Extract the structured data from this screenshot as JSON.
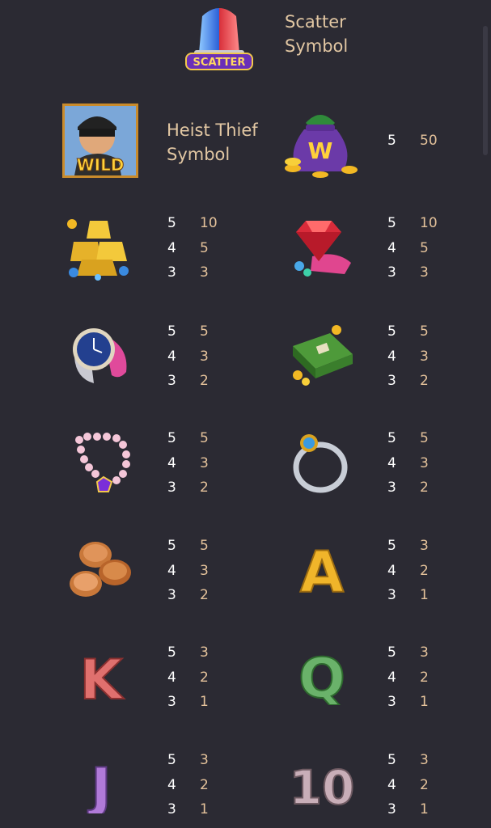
{
  "scatter": {
    "badge": "SCATTER",
    "label": "Scatter\nSymbol"
  },
  "wild": {
    "badge": "WILD",
    "label": "Heist Thief\nSymbol"
  },
  "icons": {
    "scatter": "siren-scatter-icon",
    "wild": "thief-wild-icon",
    "bag": "money-bag-w-icon",
    "gold": "gold-bars-icon",
    "ruby": "ruby-gem-icon",
    "watch": "wristwatch-icon",
    "cash": "cash-stack-icon",
    "necklace": "pearl-necklace-icon",
    "ring": "ring-icon",
    "coins": "coins-icon",
    "a": "letter-a-icon",
    "k": "letter-k-icon",
    "q": "letter-q-icon",
    "j": "letter-j-icon",
    "ten": "number-ten-icon"
  },
  "letters": {
    "w": "W",
    "a": "A",
    "k": "K",
    "q": "Q",
    "j": "J",
    "ten": "10"
  },
  "paytables": {
    "bag": [
      {
        "count": "5",
        "pay": "50"
      }
    ],
    "gold": [
      {
        "count": "5",
        "pay": "10"
      },
      {
        "count": "4",
        "pay": "5"
      },
      {
        "count": "3",
        "pay": "3"
      }
    ],
    "ruby": [
      {
        "count": "5",
        "pay": "10"
      },
      {
        "count": "4",
        "pay": "5"
      },
      {
        "count": "3",
        "pay": "3"
      }
    ],
    "watch": [
      {
        "count": "5",
        "pay": "5"
      },
      {
        "count": "4",
        "pay": "3"
      },
      {
        "count": "3",
        "pay": "2"
      }
    ],
    "cash": [
      {
        "count": "5",
        "pay": "5"
      },
      {
        "count": "4",
        "pay": "3"
      },
      {
        "count": "3",
        "pay": "2"
      }
    ],
    "necklace": [
      {
        "count": "5",
        "pay": "5"
      },
      {
        "count": "4",
        "pay": "3"
      },
      {
        "count": "3",
        "pay": "2"
      }
    ],
    "ring": [
      {
        "count": "5",
        "pay": "5"
      },
      {
        "count": "4",
        "pay": "3"
      },
      {
        "count": "3",
        "pay": "2"
      }
    ],
    "coins": [
      {
        "count": "5",
        "pay": "5"
      },
      {
        "count": "4",
        "pay": "3"
      },
      {
        "count": "3",
        "pay": "2"
      }
    ],
    "a": [
      {
        "count": "5",
        "pay": "3"
      },
      {
        "count": "4",
        "pay": "2"
      },
      {
        "count": "3",
        "pay": "1"
      }
    ],
    "k": [
      {
        "count": "5",
        "pay": "3"
      },
      {
        "count": "4",
        "pay": "2"
      },
      {
        "count": "3",
        "pay": "1"
      }
    ],
    "q": [
      {
        "count": "5",
        "pay": "3"
      },
      {
        "count": "4",
        "pay": "2"
      },
      {
        "count": "3",
        "pay": "1"
      }
    ],
    "j": [
      {
        "count": "5",
        "pay": "3"
      },
      {
        "count": "4",
        "pay": "2"
      },
      {
        "count": "3",
        "pay": "1"
      }
    ],
    "ten": [
      {
        "count": "5",
        "pay": "3"
      },
      {
        "count": "4",
        "pay": "2"
      },
      {
        "count": "3",
        "pay": "1"
      }
    ]
  }
}
